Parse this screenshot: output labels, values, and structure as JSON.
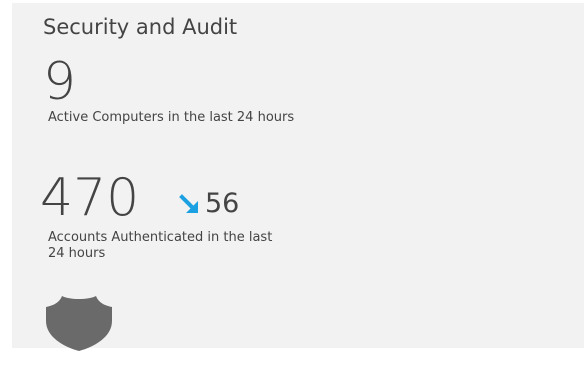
{
  "tile": {
    "title": "Security and Audit",
    "icon": "shield-icon",
    "metrics": [
      {
        "value": "9",
        "label": "Active Computers in the last 24 hours"
      },
      {
        "value": "470",
        "trend_value": "56",
        "trend_direction": "down",
        "trend_icon": "arrow-down-right-icon",
        "label": "Accounts Authenticated in the last 24 hours"
      }
    ]
  },
  "colors": {
    "tile_background": "#f2f2f2",
    "text": "#444444",
    "accent": "#1ba1e2",
    "icon": "#6a6a6a"
  }
}
